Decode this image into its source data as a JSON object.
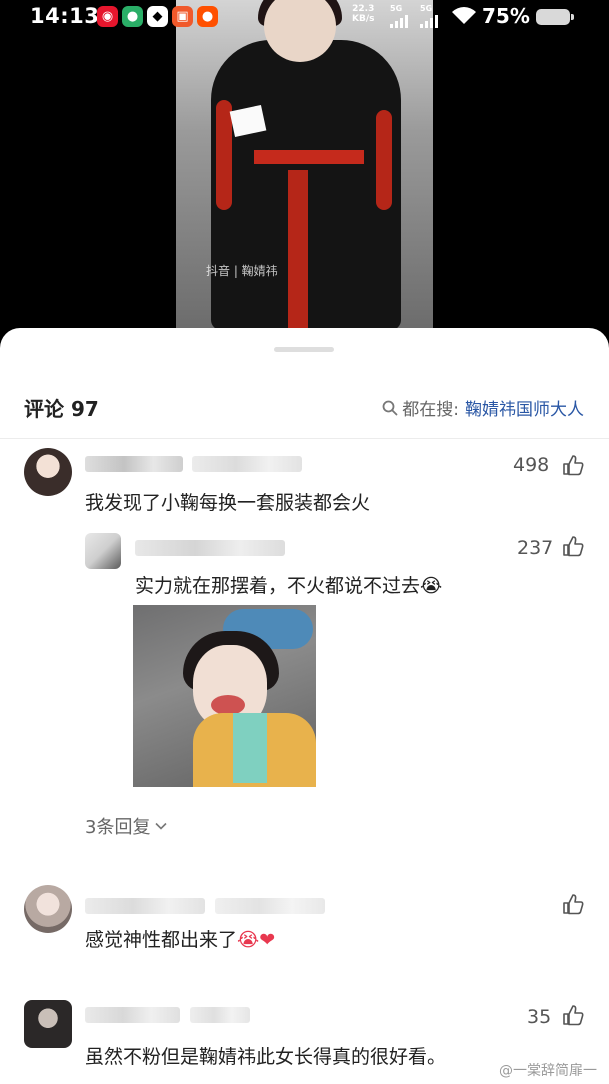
{
  "status_bar": {
    "time": "14:13",
    "net_speed_value": "22.3",
    "net_speed_unit": "KB/s",
    "sim1": "5G",
    "sim2": "5G",
    "battery": "75%",
    "app_icons": [
      "weibo-icon",
      "wechat-icon",
      "qq-icon",
      "app-icon",
      "taobao-icon"
    ]
  },
  "video": {
    "watermark": "抖音 | 鞠婧祎"
  },
  "comments": {
    "title": "评论 97",
    "search_prefix": "都在搜:",
    "search_keyword": "鞠婧祎国师大人",
    "items": [
      {
        "likes": "498",
        "text": "我发现了小鞠每换一套服装都会火",
        "reply": {
          "likes": "237",
          "text": "实力就在那摆着，不火都说不过去",
          "emoji": "😭"
        },
        "more_replies": "3条回复"
      },
      {
        "likes": "",
        "text": "感觉神性都出来了",
        "emoji": "😭❤"
      },
      {
        "likes": "35",
        "text": "虽然不粉但是鞠婧祎此女长得真的很好看。"
      }
    ]
  },
  "watermark": "@一棠辞简扉一",
  "colors": {
    "accent_link": "#2a57a5",
    "text_primary": "#222222",
    "text_secondary": "#666666"
  }
}
